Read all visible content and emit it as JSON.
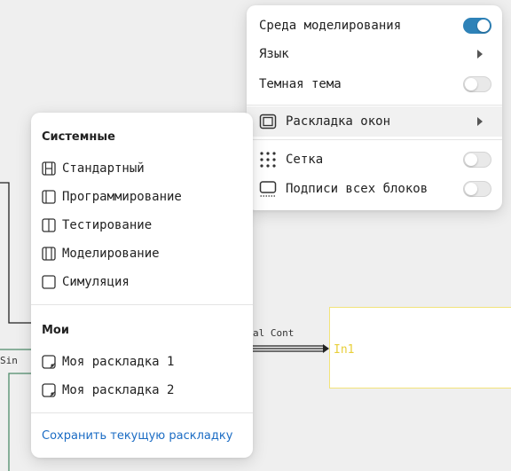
{
  "canvas": {
    "signal_label": "al Cont",
    "sin_label": "Sin",
    "in1_port_label": "In1"
  },
  "main_menu": {
    "items": [
      {
        "label": "Среда моделирования",
        "control": "toggle",
        "on": true
      },
      {
        "label": "Язык",
        "control": "submenu"
      },
      {
        "label": "Темная тема",
        "control": "toggle",
        "on": false
      },
      {
        "label": "Раскладка окон",
        "control": "submenu",
        "icon": "window-layout-icon",
        "highlighted": true
      },
      {
        "label": "Сетка",
        "control": "toggle",
        "on": false,
        "icon": "grid-dots-icon"
      },
      {
        "label": "Подписи всех блоков",
        "control": "toggle",
        "on": false,
        "icon": "block-labels-icon"
      }
    ]
  },
  "layout_menu": {
    "system_title": "Системные",
    "system_items": [
      {
        "label": "Стандартный",
        "icon": "layout-standard-icon"
      },
      {
        "label": "Программирование",
        "icon": "layout-programming-icon"
      },
      {
        "label": "Тестирование",
        "icon": "layout-testing-icon"
      },
      {
        "label": "Моделирование",
        "icon": "layout-modeling-icon"
      },
      {
        "label": "Симуляция",
        "icon": "layout-simulation-icon"
      }
    ],
    "mine_title": "Мои",
    "mine_items": [
      {
        "label": "Моя раскладка 1",
        "icon": "custom-layout-icon"
      },
      {
        "label": "Моя раскладка 2",
        "icon": "custom-layout-icon"
      }
    ],
    "save_link": "Сохранить текущую раскладку"
  },
  "colors": {
    "accent": "#2e82b8",
    "link": "#1b6cc4",
    "in1_block_border": "#f2e37a",
    "in1_label": "#e8cf3a",
    "wire_green": "#4d8a6a"
  }
}
